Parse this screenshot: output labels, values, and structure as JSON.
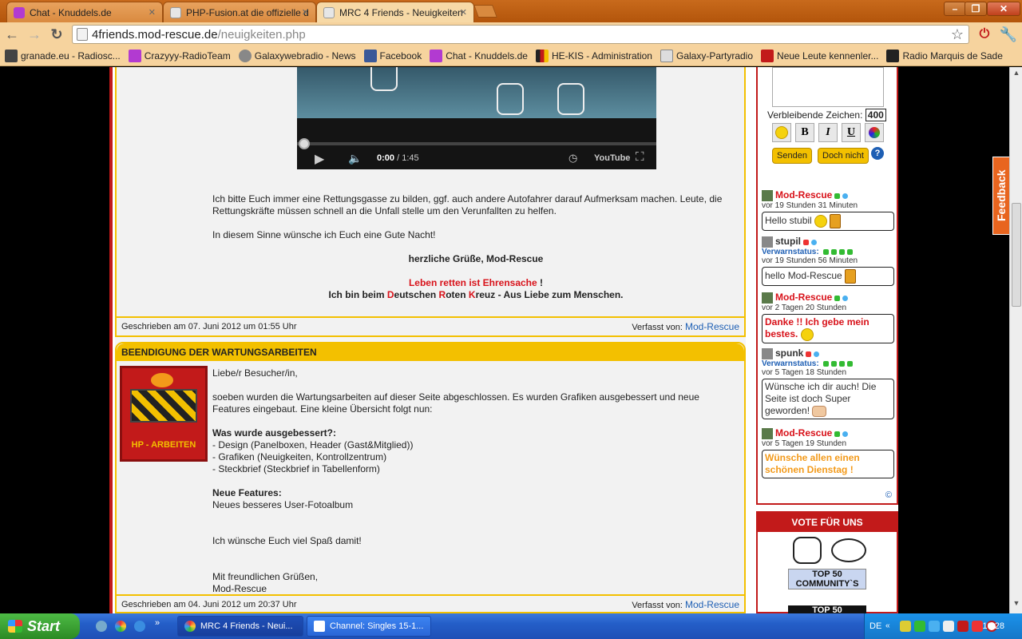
{
  "browser": {
    "tabs": [
      {
        "label": "Chat - Knuddels.de",
        "color": "#b23ad1"
      },
      {
        "label": "PHP-Fusion.at die offizielle de",
        "color": "#e6e6e6"
      },
      {
        "label": "MRC 4 Friends - Neuigkeiten",
        "color": "#e6e6e6"
      }
    ],
    "url_host": "4friends.mod-rescue.de",
    "url_path": "/neuigkeiten.php",
    "bookmarks": [
      {
        "label": "granade.eu - Radiosc...",
        "color": "#444"
      },
      {
        "label": "Crazyyy-RadioTeam",
        "color": "#b23ad1"
      },
      {
        "label": "Galaxywebradio - News",
        "color": "#888"
      },
      {
        "label": "Facebook",
        "color": "#3b5998"
      },
      {
        "label": "Chat - Knuddels.de",
        "color": "#b23ad1"
      },
      {
        "label": "HE-KIS - Administration",
        "color": "#222"
      },
      {
        "label": "Galaxy-Partyradio",
        "color": "#888"
      },
      {
        "label": "Neue Leute kennenler...",
        "color": "#c21a1a"
      },
      {
        "label": "Radio Marquis de Sade",
        "color": "#222"
      }
    ]
  },
  "video": {
    "time": "0:00",
    "duration": "/ 1:45",
    "brand": "YouTube"
  },
  "post1": {
    "p1": "Ich bitte Euch immer eine Rettungsgasse zu bilden, ggf. auch andere Autofahrer darauf Aufmerksam machen. Leute, die Rettungskräfte müssen schnell an die Unfall stelle um den Verunfallten zu helfen.",
    "p2": "In diesem Sinne wünsche ich Euch eine Gute Nacht!",
    "greeting": "herzliche Grüße, Mod-Rescue",
    "slogan_red": "Leben retten ist Ehrensache",
    "slogan_suffix": " !",
    "drk_prefix": "Ich bin beim ",
    "drk_d": "D",
    "drk_eutschen": "eutschen ",
    "drk_r": "R",
    "drk_oten": "oten ",
    "drk_k": "K",
    "drk_rest": "reuz - Aus Liebe zum Menschen.",
    "written": "Geschrieben am 07. Juni 2012 um 01:55 Uhr",
    "by_label": "Verfasst von: ",
    "author": "Mod-Rescue"
  },
  "post2": {
    "title": "BEENDIGUNG DER WARTUNGSARBEITEN",
    "image_caption": "HP - ARBEITEN",
    "greeting": "Liebe/r Besucher/in,",
    "intro": "soeben wurden die Wartungsarbeiten auf dieser Seite abgeschlossen. Es wurden Grafiken ausgebessert und neue Features eingebaut. Eine kleine Übersicht folgt nun:",
    "fixed_title": "Was wurde ausgebessert?:",
    "fixed": [
      "- Design (Panelboxen, Header (Gast&Mitglied))",
      "- Grafiken (Neuigkeiten, Kontrollzentrum)",
      "- Steckbrief (Steckbrief in Tabellenform)"
    ],
    "features_title": "Neue Features:",
    "features": "Neues besseres User-Fotoalbum",
    "wish": "Ich wünsche Euch viel Spaß damit!",
    "closing1": "Mit freundlichen Grüßen,",
    "closing2": "Mod-Rescue",
    "written": "Geschrieben am 04. Juni 2012 um 20:37 Uhr",
    "by_label": "Verfasst von: ",
    "author": "Mod-Rescue"
  },
  "shoutbox": {
    "remaining_label": "Verbleibende Zeichen:",
    "remaining": "400",
    "send": "Senden",
    "cancel": "Doch nicht",
    "help": "?",
    "warn_label": "Verwarnstatus:",
    "entries": [
      {
        "name": "Mod-Rescue",
        "time": "vor 19 Stunden 31 Minuten",
        "msg": "Hello stubil"
      },
      {
        "name": "stupil",
        "time": "vor 19 Stunden 56 Minuten",
        "msg": "hello Mod-Rescue"
      },
      {
        "name": "Mod-Rescue",
        "time": "vor 2 Tagen 20 Stunden",
        "msg": "Danke !! Ich gebe mein bestes."
      },
      {
        "name": "spunk",
        "time": "vor 5 Tagen 18 Stunden",
        "msg": "Wünsche ich dir auch! Die Seite ist doch Super geworden!"
      },
      {
        "name": "Mod-Rescue",
        "time": "vor 5 Tagen 19 Stunden",
        "msg": "Wünsche allen einen schönen Dienstag !"
      }
    ],
    "copyright": "©"
  },
  "vote": {
    "title": "VOTE FÜR UNS",
    "badge1_line1": "TOP 50",
    "badge1_line2": "COMMUNITY`S",
    "badge2": "TOP 50"
  },
  "feedback": "Feedback",
  "taskbar": {
    "start": "Start",
    "tasks": [
      "MRC 4 Friends - Neui...",
      "Channel: Singles 15-1..."
    ],
    "lang": "DE",
    "time": "10:28"
  }
}
